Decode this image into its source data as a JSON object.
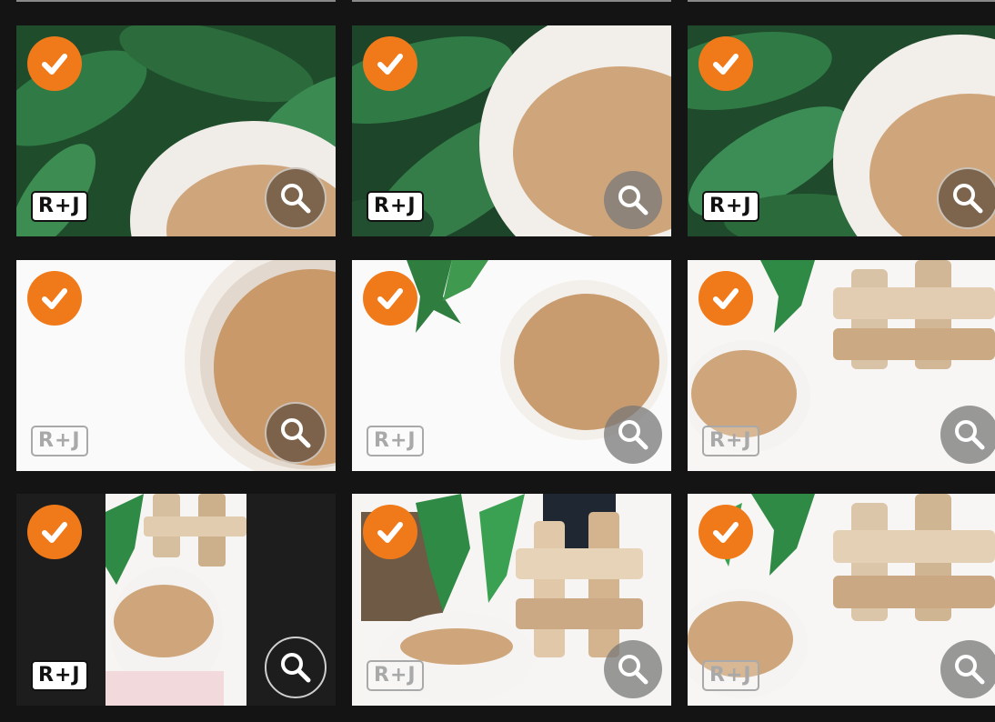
{
  "gallery": {
    "accent_color": "#f07a1a",
    "tiles": [
      {
        "name": "photo-1",
        "watermark": "R+J",
        "selected": true,
        "badge_style": "solid",
        "zoom_style": "brown"
      },
      {
        "name": "photo-2",
        "watermark": "R+J",
        "selected": true,
        "badge_style": "solid",
        "zoom_style": "grey"
      },
      {
        "name": "photo-3",
        "watermark": "R+J",
        "selected": true,
        "badge_style": "solid",
        "zoom_style": "brown"
      },
      {
        "name": "photo-4",
        "watermark": "R+J",
        "selected": true,
        "badge_style": "ghost",
        "zoom_style": "brown"
      },
      {
        "name": "photo-5",
        "watermark": "R+J",
        "selected": true,
        "badge_style": "ghost",
        "zoom_style": "grey"
      },
      {
        "name": "photo-6",
        "watermark": "R+J",
        "selected": true,
        "badge_style": "ghost",
        "zoom_style": "grey"
      },
      {
        "name": "photo-7",
        "watermark": "R+J",
        "selected": true,
        "badge_style": "solid",
        "zoom_style": "dark"
      },
      {
        "name": "photo-8",
        "watermark": "R+J",
        "selected": true,
        "badge_style": "ghost",
        "zoom_style": "grey"
      },
      {
        "name": "photo-9",
        "watermark": "R+J",
        "selected": true,
        "badge_style": "ghost",
        "zoom_style": "grey"
      }
    ],
    "icons": {
      "select": "checkmark-icon",
      "zoom": "magnifier-icon"
    }
  }
}
